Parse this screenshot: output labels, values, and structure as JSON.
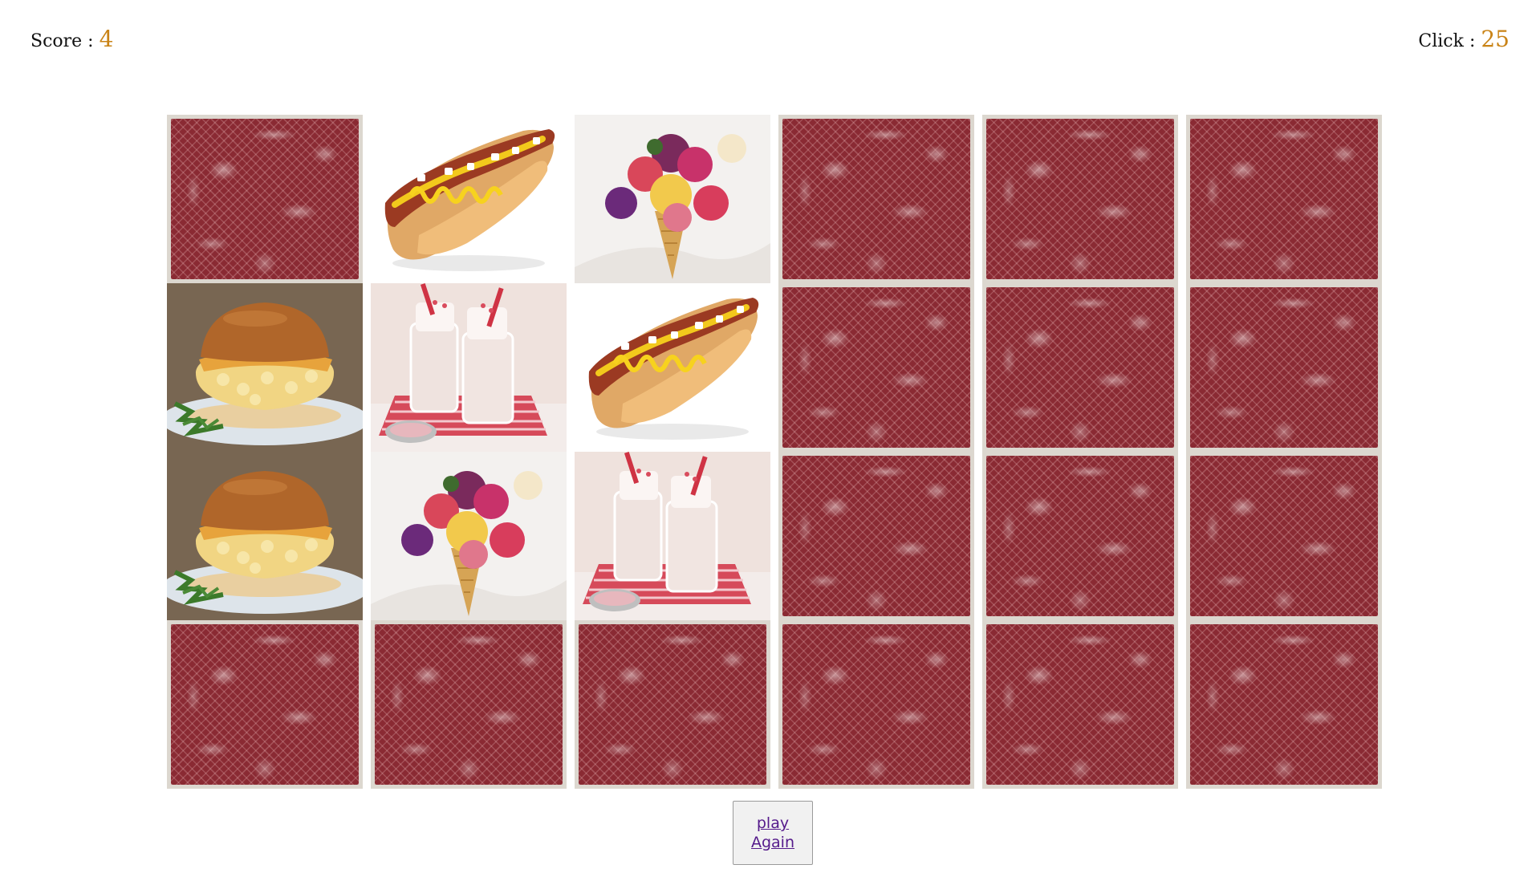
{
  "score": {
    "label": "Score : ",
    "value": "4"
  },
  "clicks": {
    "label": "Click : ",
    "value": "25"
  },
  "board": {
    "columns": 6,
    "rows": 4,
    "cards": [
      {
        "state": "hidden"
      },
      {
        "state": "revealed",
        "food": "hotdog"
      },
      {
        "state": "revealed",
        "food": "ice-cream"
      },
      {
        "state": "hidden"
      },
      {
        "state": "hidden"
      },
      {
        "state": "hidden"
      },
      {
        "state": "revealed",
        "food": "burger"
      },
      {
        "state": "revealed",
        "food": "milkshake"
      },
      {
        "state": "revealed",
        "food": "hotdog"
      },
      {
        "state": "hidden"
      },
      {
        "state": "hidden"
      },
      {
        "state": "hidden"
      },
      {
        "state": "revealed",
        "food": "burger"
      },
      {
        "state": "revealed",
        "food": "ice-cream"
      },
      {
        "state": "revealed",
        "food": "milkshake"
      },
      {
        "state": "hidden"
      },
      {
        "state": "hidden"
      },
      {
        "state": "hidden"
      },
      {
        "state": "hidden"
      },
      {
        "state": "hidden"
      },
      {
        "state": "hidden"
      },
      {
        "state": "hidden"
      },
      {
        "state": "hidden"
      },
      {
        "state": "hidden"
      }
    ]
  },
  "play_again": {
    "label": "play Again"
  },
  "colors": {
    "card_back": "#8a2a33",
    "card_border": "#dcd7cf",
    "counter_value": "#c98316",
    "link": "#551a8b"
  }
}
